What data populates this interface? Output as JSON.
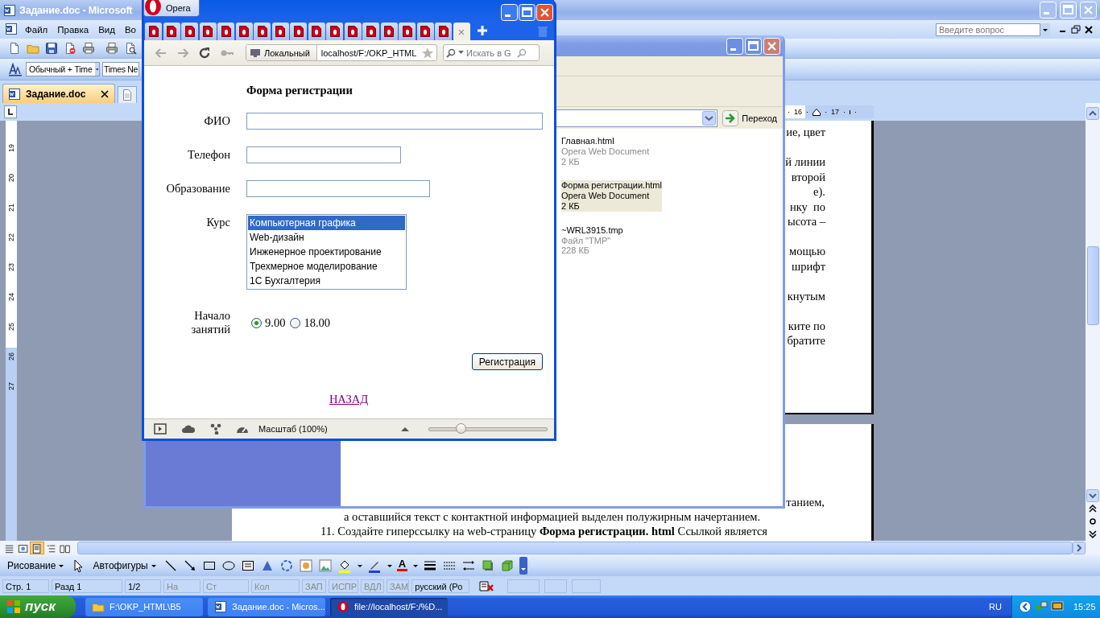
{
  "word": {
    "title": "Задание.doc - Microsoft",
    "menu": [
      {
        "label": "Файл"
      },
      {
        "label": "Правка"
      },
      {
        "label": "Вид"
      },
      {
        "label": "Во"
      }
    ],
    "help_placeholder": "Введите вопрос",
    "style_box": "Обычный + Time",
    "font_box": "Times Ne",
    "doc_tab": {
      "label": "Задание.doc",
      "selected": true
    },
    "ruler_numbers": [
      "16",
      "17"
    ],
    "vertical_ruler": [
      "19",
      "20",
      "21",
      "22",
      "23",
      "24",
      "25",
      "26",
      "27"
    ],
    "page1_paragraphs": [
      [
        "ие, цвет"
      ],
      [
        "й линии",
        "второй",
        "е).",
        "нку  по",
        "ысота –"
      ],
      [
        "мощью",
        "шрифт"
      ],
      [
        "кнутым"
      ],
      [
        "ките по",
        "братите"
      ]
    ],
    "page2_lines": [
      "танием,",
      "а оставшийся текст с контактной информацией выделен полужирным начертанием.",
      "11. Создайте гиперссылку на web-страницу **Форма регистрации. html** Ссылкой является"
    ],
    "views": [
      {
        "selected": false
      },
      {
        "selected": false
      },
      {
        "selected": true
      },
      {
        "selected": false
      },
      {
        "selected": false
      }
    ],
    "draw_menu": "Рисование",
    "autoshapes_menu": "Автофигуры",
    "font_color_glyph": "A",
    "status": [
      {
        "text": "Стр. 1",
        "disabled": false
      },
      {
        "text": "Разд 1",
        "disabled": false
      },
      {
        "text": "1/2",
        "disabled": false
      },
      {
        "text": "На",
        "disabled": true
      },
      {
        "text": "Ст",
        "disabled": true
      },
      {
        "text": "Кол",
        "disabled": true
      },
      {
        "text": "ЗАП",
        "disabled": true
      },
      {
        "text": "ИСПР",
        "disabled": true
      },
      {
        "text": "ВДЛ",
        "disabled": true
      },
      {
        "text": "ЗАМ",
        "disabled": true
      },
      {
        "text": "русский (Ро",
        "disabled": false
      }
    ]
  },
  "explorer": {
    "go_button": "Переход",
    "files": [
      {
        "name": "Главная.html",
        "type": "Opera Web Document",
        "size": "2 КБ",
        "selected": false
      },
      {
        "name": "Форма регистрации.html",
        "type": "Opera Web Document",
        "size": "2 КБ",
        "selected": true
      },
      {
        "name": "~WRL3915.tmp",
        "type": "Файл \"TMP\"",
        "size": "228 КБ",
        "selected": false
      }
    ]
  },
  "opera": {
    "menu_button": "Opera",
    "tabs": [
      {
        "selected": false
      },
      {
        "selected": false
      },
      {
        "selected": false
      },
      {
        "selected": false
      },
      {
        "selected": false
      },
      {
        "selected": false
      },
      {
        "selected": false
      },
      {
        "selected": false
      },
      {
        "selected": false
      },
      {
        "selected": false
      },
      {
        "selected": false
      },
      {
        "selected": false
      },
      {
        "selected": false
      },
      {
        "selected": false
      },
      {
        "selected": false
      },
      {
        "selected": false
      },
      {
        "selected": false
      },
      {
        "selected": true,
        "close": "×"
      }
    ],
    "location_badge": "Локальный",
    "address": "localhost/F:/OKP_HTML",
    "search_placeholder": "Искать в G",
    "form": {
      "heading": "Форма регистрации",
      "fields": [
        {
          "label": "ФИО"
        },
        {
          "label": "Телефон"
        },
        {
          "label": "Образование"
        }
      ],
      "course": {
        "label": "Курс",
        "options": [
          {
            "text": "Компьютерная графика",
            "selected": true
          },
          {
            "text": "Web-дизайн",
            "selected": false
          },
          {
            "text": "Инженерное проектирование",
            "selected": false
          },
          {
            "text": "Трехмерное моделирование",
            "selected": false
          },
          {
            "text": "1С Бухгалтерия",
            "selected": false
          }
        ]
      },
      "start": {
        "label": "Начало занятий",
        "options": [
          {
            "text": "9.00",
            "selected": true
          },
          {
            "text": "18.00",
            "selected": false
          }
        ]
      },
      "submit": "Регистрация",
      "back_link": "НАЗАД"
    },
    "zoom_label": "Масштаб (100%)",
    "zoom": {
      "level": 0.27
    }
  },
  "taskbar": {
    "start": "пуск",
    "tasks": [
      {
        "label": "F:\\OKP_HTML\\B5",
        "kind": "folder",
        "selected": false
      },
      {
        "label": "Задание.doc - Micros...",
        "kind": "word",
        "selected": false
      },
      {
        "label": "file://localhost/F:/%D...",
        "kind": "opera",
        "selected": true
      }
    ],
    "language": "RU",
    "clock": "15:25"
  }
}
